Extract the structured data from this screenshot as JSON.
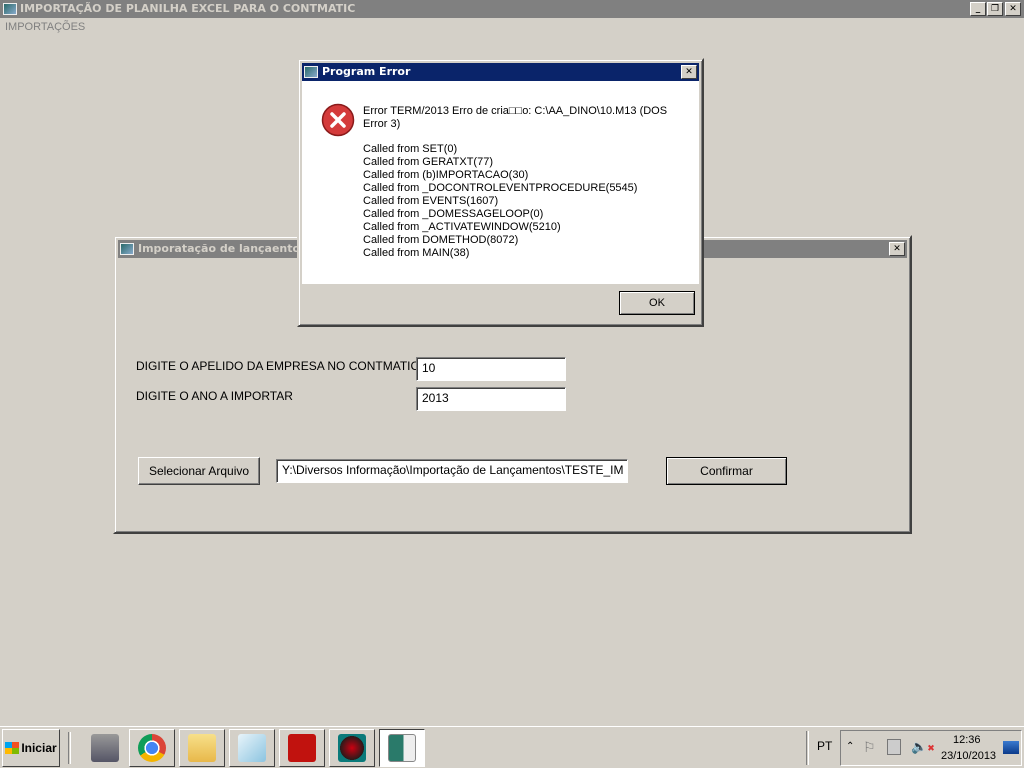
{
  "app": {
    "title": "IMPORTAÇÃO DE PLANILHA EXCEL PARA O CONTMATIC",
    "menu": [
      "IMPORTAÇÕES"
    ],
    "min": "_",
    "restore": "❐",
    "close": "✕"
  },
  "form": {
    "title": "Imporatação de lançaentos",
    "close": "✕",
    "company_label": "DIGITE O APELIDO DA EMPRESA NO CONTMATIC",
    "company_value": "10",
    "year_label": "DIGITE O ANO A IMPORTAR",
    "year_value": "2013",
    "select_button": "Selecionar Arquivo",
    "file_path": "Y:\\Diversos Informação\\Importação de Lançamentos\\TESTE_IM",
    "confirm_button": "Confirmar"
  },
  "error_dialog": {
    "title": "Program Error",
    "close": "✕",
    "message": "Error TERM/2013  Erro de cria□□o: C:\\AA_DINO\\10.M13 (DOS Error 3)",
    "stack": [
      "Called from SET(0)",
      "Called from GERATXT(77)",
      "Called from (b)IMPORTACAO(30)",
      "Called from _DOCONTROLEVENTPROCEDURE(5545)",
      "Called from EVENTS(1607)",
      "Called from _DOMESSAGELOOP(0)",
      "Called from _ACTIVATEWINDOW(5210)",
      "Called from DOMETHOD(8072)",
      "Called from MAIN(38)"
    ],
    "ok": "OK"
  },
  "taskbar": {
    "start": "Iniciar",
    "apps": [
      "server-manager",
      "chrome",
      "explorer",
      "notepad",
      "acrobat",
      "app-red",
      "contmatic-import"
    ],
    "lang": "PT",
    "time": "12:36",
    "date": "23/10/2013"
  }
}
